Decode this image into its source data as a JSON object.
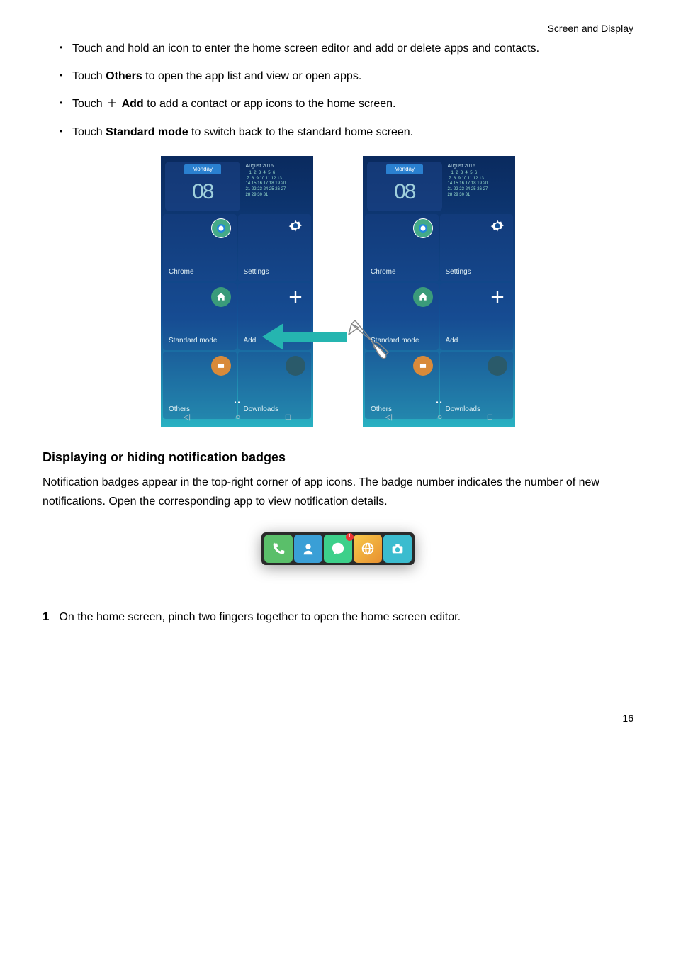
{
  "header": {
    "breadcrumb": "Screen and Display"
  },
  "bullets": {
    "b1a": "Touch and hold an icon to enter the home screen editor and add or delete apps and contacts.",
    "b2a": "Touch ",
    "b2b": "Others",
    "b2c": " to open the app list and view or open apps.",
    "b3a": "Touch ",
    "b3b": "Add",
    "b3c": " to add a contact or app icons to the home screen.",
    "b4a": "Touch ",
    "b4b": "Standard mode",
    "b4c": " to switch back to the standard home screen."
  },
  "phone": {
    "day": "Monday",
    "date": "08",
    "month": "August 2016",
    "cal_rows": [
      "   1  2  3  4  5  6",
      " 7  8  9 10 11 12 13",
      "14 15 16 17 18 19 20",
      "21 22 23 24 25 26 27",
      "28 29 30 31"
    ],
    "apps": {
      "chrome": "Chrome",
      "settings": "Settings",
      "standard": "Standard mode",
      "add": "Add",
      "others": "Others",
      "downloads": "Downloads"
    }
  },
  "section": {
    "title": "Displaying or hiding notification badges",
    "body": "Notification badges appear in the top-right corner of app icons. The badge number indicates the number of new notifications. Open the corresponding app to view notification details."
  },
  "dock": {
    "badge": "1"
  },
  "step": {
    "num": "1",
    "text": "On the home screen, pinch two fingers together to open the home screen editor."
  },
  "page_num": "16"
}
